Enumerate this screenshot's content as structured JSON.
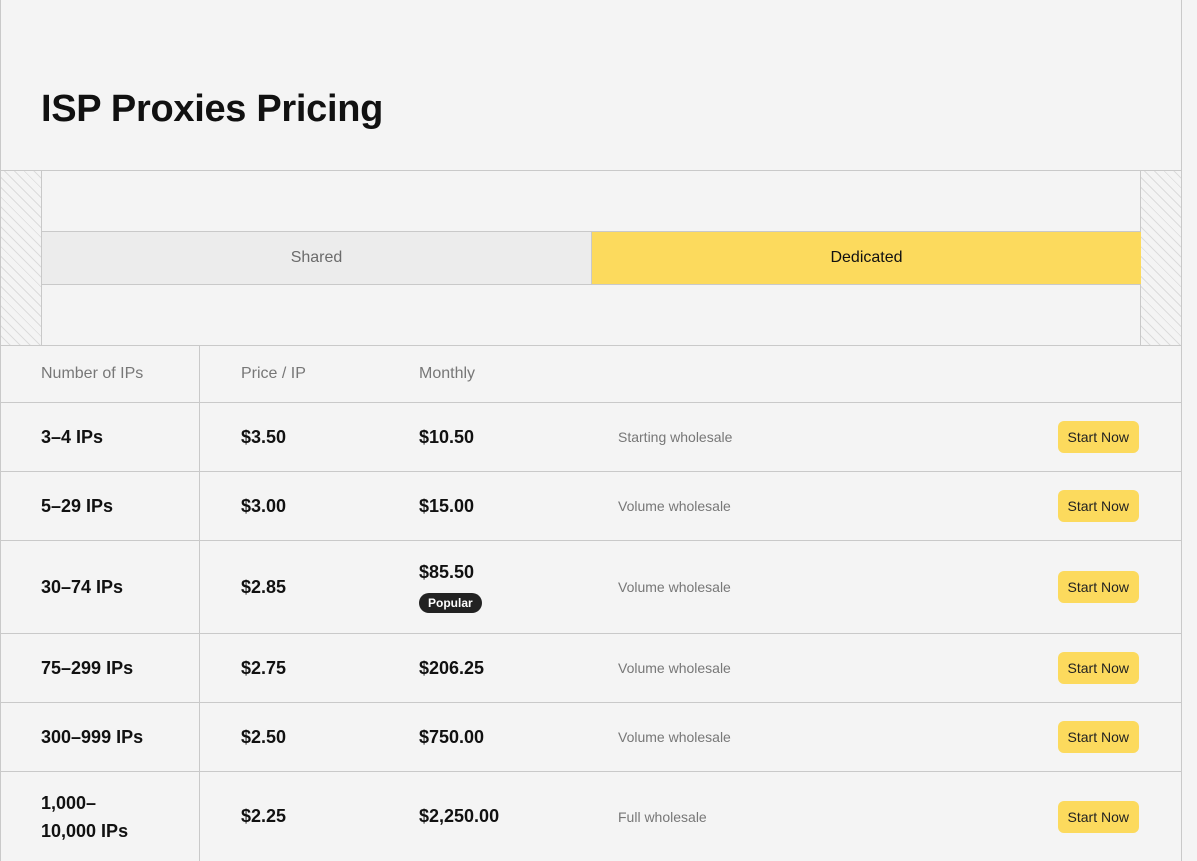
{
  "page": {
    "title": "ISP Proxies Pricing"
  },
  "tabs": [
    {
      "label": "Shared",
      "active": false
    },
    {
      "label": "Dedicated",
      "active": true
    }
  ],
  "colors": {
    "accent": "#fcda5d",
    "badge": "#222222"
  },
  "table": {
    "headers": [
      "Number of IPs",
      "Price / IP",
      "Monthly"
    ],
    "rows": [
      {
        "ips": "3–4 IPs",
        "price": "$3.50",
        "monthly": "$10.50",
        "badge": "",
        "tier": "Starting wholesale",
        "cta": "Start Now"
      },
      {
        "ips": "5–29 IPs",
        "price": "$3.00",
        "monthly": "$15.00",
        "badge": "",
        "tier": "Volume wholesale",
        "cta": "Start Now"
      },
      {
        "ips": "30–74 IPs",
        "price": "$2.85",
        "monthly": "$85.50",
        "badge": "Popular",
        "tier": "Volume wholesale",
        "cta": "Start Now"
      },
      {
        "ips": "75–299 IPs",
        "price": "$2.75",
        "monthly": "$206.25",
        "badge": "",
        "tier": "Volume wholesale",
        "cta": "Start Now"
      },
      {
        "ips": "300–999 IPs",
        "price": "$2.50",
        "monthly": "$750.00",
        "badge": "",
        "tier": "Volume wholesale",
        "cta": "Start Now"
      },
      {
        "ips": "1,000–10,000 IPs",
        "price": "$2.25",
        "monthly": "$2,250.00",
        "badge": "",
        "tier": "Full wholesale",
        "cta": "Start Now"
      }
    ]
  }
}
